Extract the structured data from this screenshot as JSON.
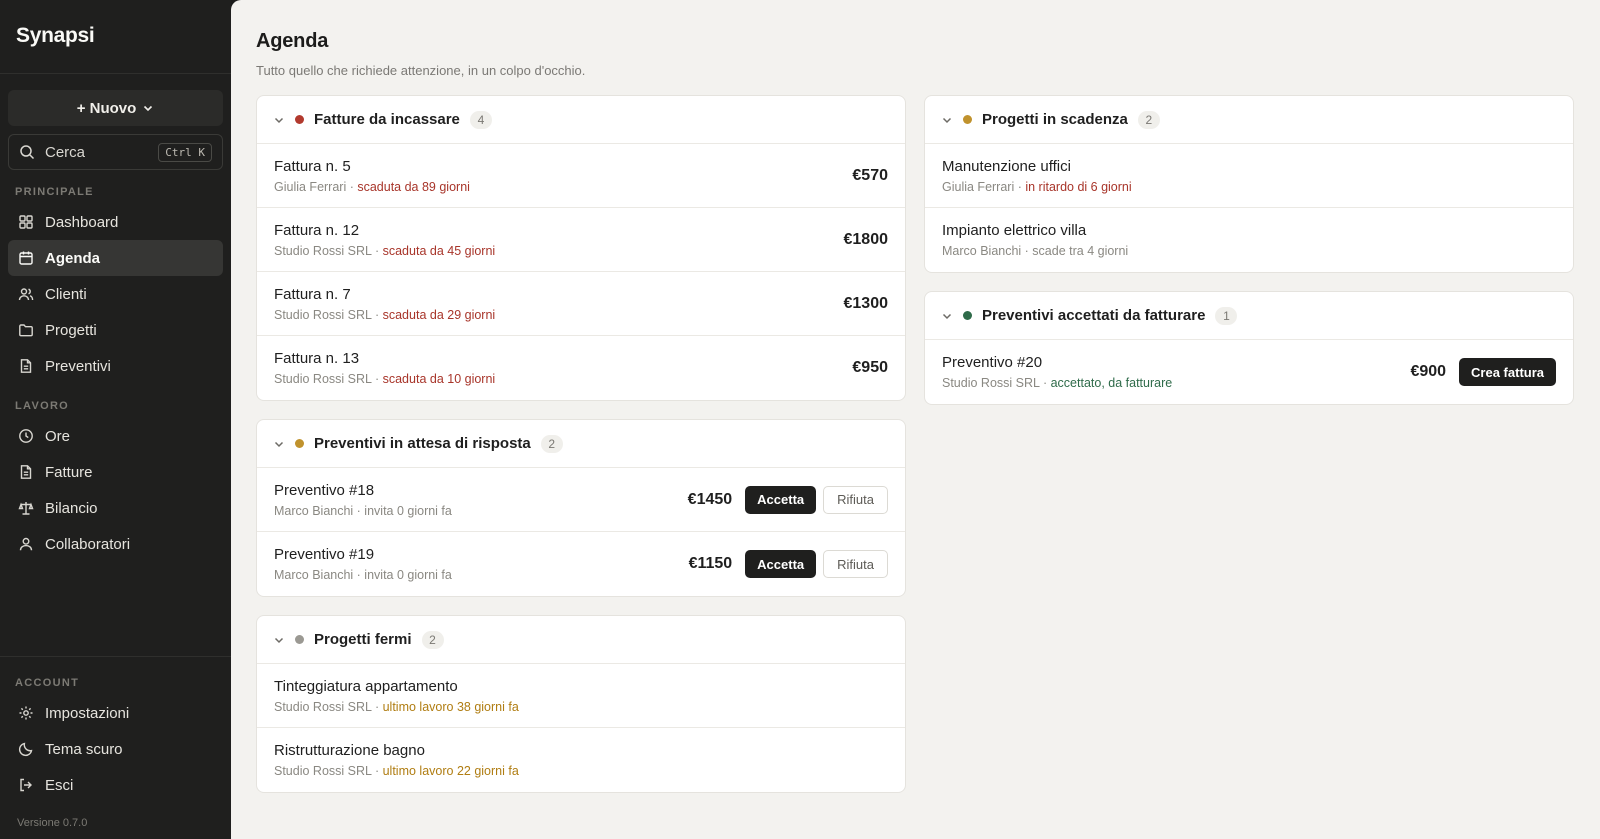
{
  "app": {
    "name": "Synapsi",
    "version": "Versione 0.7.0"
  },
  "sidebar": {
    "new_label": "+ Nuovo",
    "search": {
      "label": "Cerca",
      "shortcut": "Ctrl K"
    },
    "sections": {
      "principale": "PRINCIPALE",
      "lavoro": "LAVORO",
      "account": "ACCOUNT"
    },
    "items": {
      "dashboard": "Dashboard",
      "agenda": "Agenda",
      "clienti": "Clienti",
      "progetti": "Progetti",
      "preventivi": "Preventivi",
      "ore": "Ore",
      "fatture": "Fatture",
      "bilancio": "Bilancio",
      "collaboratori": "Collaboratori",
      "impostazioni": "Impostazioni",
      "tema": "Tema scuro",
      "esci": "Esci"
    }
  },
  "header": {
    "title": "Agenda",
    "subtitle": "Tutto quello che richiede attenzione, in un colpo d'occhio."
  },
  "colors": {
    "red": "#b23a2e",
    "amber": "#c0922d",
    "gray": "#9b9993",
    "green": "#2f6b4a"
  },
  "cards": {
    "fatture": {
      "title": "Fatture da incassare",
      "count": "4",
      "rows": [
        {
          "title": "Fattura n. 5",
          "client": "Giulia Ferrari · ",
          "status": "scaduta da 89 giorni",
          "amount": "€570"
        },
        {
          "title": "Fattura n. 12",
          "client": "Studio Rossi SRL · ",
          "status": "scaduta da 45 giorni",
          "amount": "€1800"
        },
        {
          "title": "Fattura n. 7",
          "client": "Studio Rossi SRL · ",
          "status": "scaduta da 29 giorni",
          "amount": "€1300"
        },
        {
          "title": "Fattura n. 13",
          "client": "Studio Rossi SRL · ",
          "status": "scaduta da 10 giorni",
          "amount": "€950"
        }
      ]
    },
    "progetti_scadenza": {
      "title": "Progetti in scadenza",
      "count": "2",
      "rows": [
        {
          "title": "Manutenzione uffici",
          "client": "Giulia Ferrari · ",
          "status": "in ritardo di 6 giorni"
        },
        {
          "title": "Impianto elettrico villa",
          "client": "Marco Bianchi · scade tra 4 giorni"
        }
      ]
    },
    "preventivi_attesa": {
      "title": "Preventivi in attesa di risposta",
      "count": "2",
      "accept_label": "Accetta",
      "reject_label": "Rifiuta",
      "rows": [
        {
          "title": "Preventivo #18",
          "client": "Marco Bianchi · invita 0 giorni fa",
          "amount": "€1450"
        },
        {
          "title": "Preventivo #19",
          "client": "Marco Bianchi · invita 0 giorni fa",
          "amount": "€1150"
        }
      ]
    },
    "preventivi_accettati": {
      "title": "Preventivi accettati da fatturare",
      "count": "1",
      "invoice_label": "Crea fattura",
      "rows": [
        {
          "title": "Preventivo #20",
          "client": "Studio Rossi SRL · ",
          "status": "accettato, da fatturare",
          "amount": "€900"
        }
      ]
    },
    "progetti_fermi": {
      "title": "Progetti fermi",
      "count": "2",
      "rows": [
        {
          "title": "Tinteggiatura appartamento",
          "client": "Studio Rossi SRL · ",
          "status": "ultimo lavoro 38 giorni fa"
        },
        {
          "title": "Ristrutturazione bagno",
          "client": "Studio Rossi SRL · ",
          "status": "ultimo lavoro 22 giorni fa"
        }
      ]
    }
  }
}
